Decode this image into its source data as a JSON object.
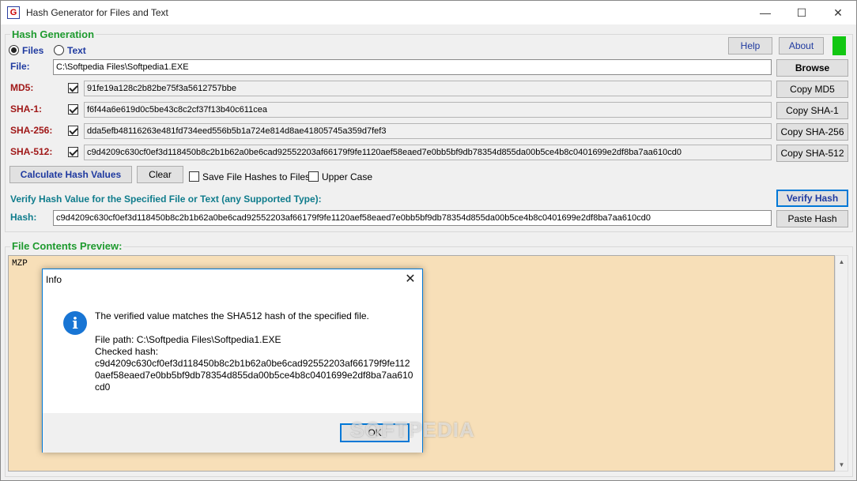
{
  "window": {
    "title": "Hash Generator for Files and Text",
    "minimize": "—",
    "maximize": "☐",
    "close": "✕"
  },
  "hash_generation": {
    "group_title": "Hash Generation",
    "radio_files": "Files",
    "radio_text": "Text",
    "help_label": "Help",
    "about_label": "About",
    "file_label": "File:",
    "file_value": "C:\\Softpedia Files\\Softpedia1.EXE",
    "browse_label": "Browse",
    "rows": [
      {
        "label": "MD5:",
        "value": "91fe19a128c2b82be75f3a5612757bbe",
        "copy_label": "Copy MD5"
      },
      {
        "label": "SHA-1:",
        "value": "f6f44a6e619d0c5be43c8c2cf37f13b40c611cea",
        "copy_label": "Copy SHA-1"
      },
      {
        "label": "SHA-256:",
        "value": "dda5efb48116263e481fd734eed556b5b1a724e814d8ae41805745a359d7fef3",
        "copy_label": "Copy SHA-256"
      },
      {
        "label": "SHA-512:",
        "value": "c9d4209c630cf0ef3d118450b8c2b1b62a0be6cad92552203af66179f9fe1120aef58eaed7e0bb5bf9db78354d855da00b5ce4b8c0401699e2df8ba7aa610cd0",
        "copy_label": "Copy SHA-512"
      }
    ],
    "calculate_label": "Calculate Hash Values",
    "clear_label": "Clear",
    "save_hashes_label": "Save File Hashes to Files",
    "upper_case_label": "Upper Case"
  },
  "verify": {
    "heading": "Verify Hash Value for the Specified File or Text (any Supported Type):",
    "verify_label": "Verify Hash",
    "hash_label": "Hash:",
    "hash_value": "c9d4209c630cf0ef3d118450b8c2b1b62a0be6cad92552203af66179f9fe1120aef58eaed7e0bb5bf9db78354d855da00b5ce4b8c0401699e2df8ba7aa610cd0",
    "paste_label": "Paste Hash"
  },
  "preview": {
    "group_title": "File Contents Preview:",
    "content": "MZP"
  },
  "dialog": {
    "title": "Info",
    "close": "✕",
    "icon": "i",
    "line1": "The verified value matches the SHA512 hash of the specified file.",
    "file_path": "File path: C:\\Softpedia Files\\Softpedia1.EXE",
    "checked_hash_label": "Checked hash:",
    "hash_line1": "c9d4209c630cf0ef3d118450b8c2b1b62a0be6cad92552203af66179f9fe112",
    "hash_line2": "0aef58eaed7e0bb5bf9db78354d855da00b5ce4b8c0401699e2df8ba7aa610",
    "hash_line3": "cd0",
    "ok_label": "OK"
  },
  "watermark": "SOFTPEDIA",
  "colors": {
    "group_title": "#1e9a2e",
    "label_blue": "#1f3aa0",
    "label_red": "#a01818",
    "label_teal": "#0f7c8c",
    "preview_bg": "#f7dfb8",
    "indicator": "#12c712"
  }
}
